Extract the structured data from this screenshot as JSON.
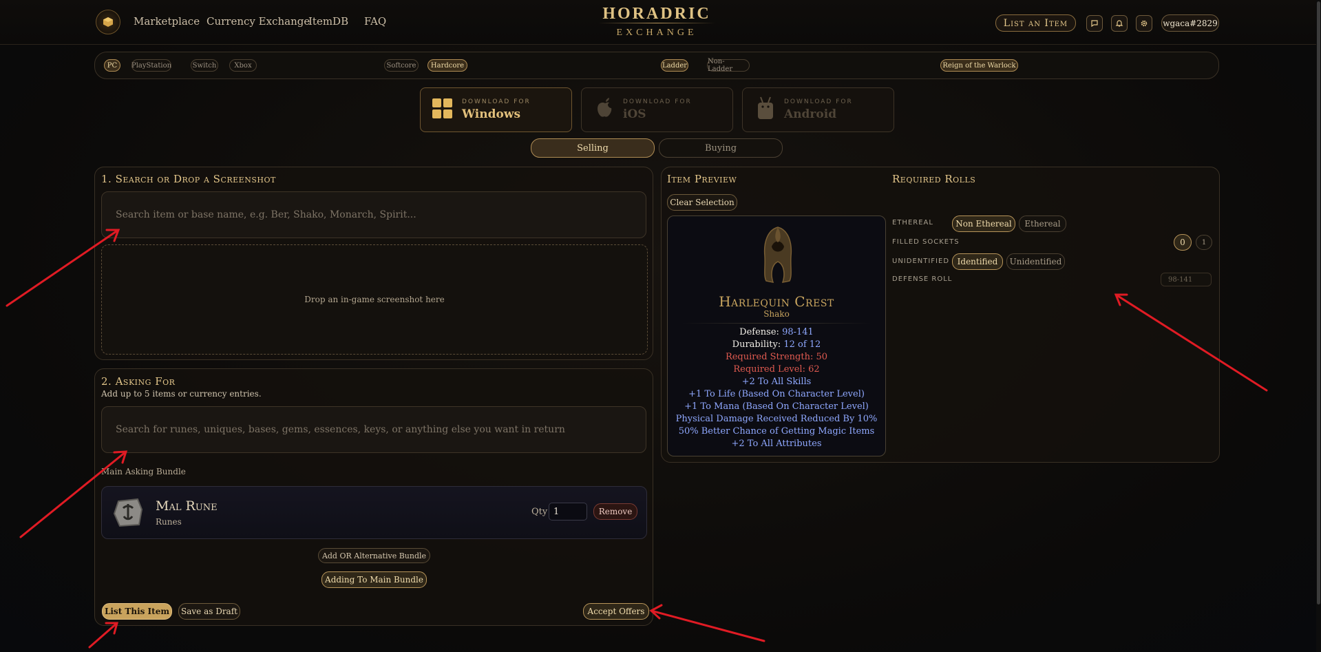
{
  "header": {
    "nav": [
      "Marketplace",
      "Currency Exchange",
      "ItemDB",
      "FAQ"
    ],
    "brand_top": "HORADRIC",
    "brand_bottom": "EXCHANGE",
    "list_item_button": "List an Item",
    "username": "wgaca#2829",
    "icons": [
      "chat-icon",
      "bell-icon",
      "gear-icon"
    ]
  },
  "filters": {
    "platforms": [
      "PC",
      "PlayStation",
      "Switch",
      "Xbox"
    ],
    "modes": [
      "Softcore",
      "Hardcore"
    ],
    "ladders": [
      "Ladder",
      "Non-Ladder"
    ],
    "season": "Reign of the Warlock",
    "active": [
      "PC",
      "Hardcore",
      "Ladder",
      "Reign of the Warlock"
    ]
  },
  "downloads": [
    {
      "small": "DOWNLOAD FOR",
      "big": "Windows"
    },
    {
      "small": "DOWNLOAD FOR",
      "big": "iOS"
    },
    {
      "small": "DOWNLOAD FOR",
      "big": "Android"
    }
  ],
  "trade_toggle": {
    "selling": "Selling",
    "buying": "Buying",
    "active": "Selling"
  },
  "search_panel": {
    "title": "1. Search or Drop a Screenshot",
    "placeholder": "Search item or base name, e.g. Ber, Shako, Monarch, Spirit...",
    "drop_text": "Drop an in-game screenshot here"
  },
  "asking_panel": {
    "title": "2. Asking For",
    "subtitle": "Add up to 5 items or currency entries.",
    "placeholder": "Search for runes, uniques, bases, gems, essences, keys, or anything else you want in return",
    "bundle_label": "Main Asking Bundle",
    "bundle_item": {
      "name": "Mal Rune",
      "type": "Runes",
      "qty_label": "Qty",
      "qty": "1",
      "remove": "Remove"
    },
    "add_alt": "Add OR Alternative Bundle",
    "adding_main": "Adding To Main Bundle",
    "list_button": "List This Item",
    "draft_button": "Save as Draft",
    "accept_button": "Accept Offers"
  },
  "preview": {
    "title": "Item Preview",
    "clear": "Clear Selection",
    "item_name": "Harlequin Crest",
    "item_base": "Shako",
    "defense_label": "Defense:",
    "defense_value": "98-141",
    "durability_label": "Durability:",
    "durability_value": "12 of 12",
    "req_str": "Required Strength: 50",
    "req_lvl": "Required Level: 62",
    "mods": [
      "+2 To All Skills",
      "+1 To Life (Based On Character Level)",
      "+1 To Mana (Based On Character Level)",
      "Physical Damage Received Reduced By 10%",
      "50% Better Chance of Getting Magic Items",
      "+2 To All Attributes"
    ],
    "colors": {
      "name": "#c9a55f",
      "mod": "#8fa8ff",
      "req": "#e05a50",
      "white": "#f2efe8"
    }
  },
  "required_rolls": {
    "title": "Required Rolls",
    "ethereal_label": "ETHEREAL",
    "ethereal_options": [
      "Non Ethereal",
      "Ethereal"
    ],
    "ethereal_active": "Non Ethereal",
    "sockets_label": "FILLED SOCKETS",
    "sockets_options": [
      "0",
      "1"
    ],
    "sockets_active": "0",
    "unid_label": "UNIDENTIFIED",
    "unid_options": [
      "Identified",
      "Unidentified"
    ],
    "unid_active": "Identified",
    "defense_label": "DEFENSE ROLL",
    "defense_placeholder": "98-141"
  }
}
